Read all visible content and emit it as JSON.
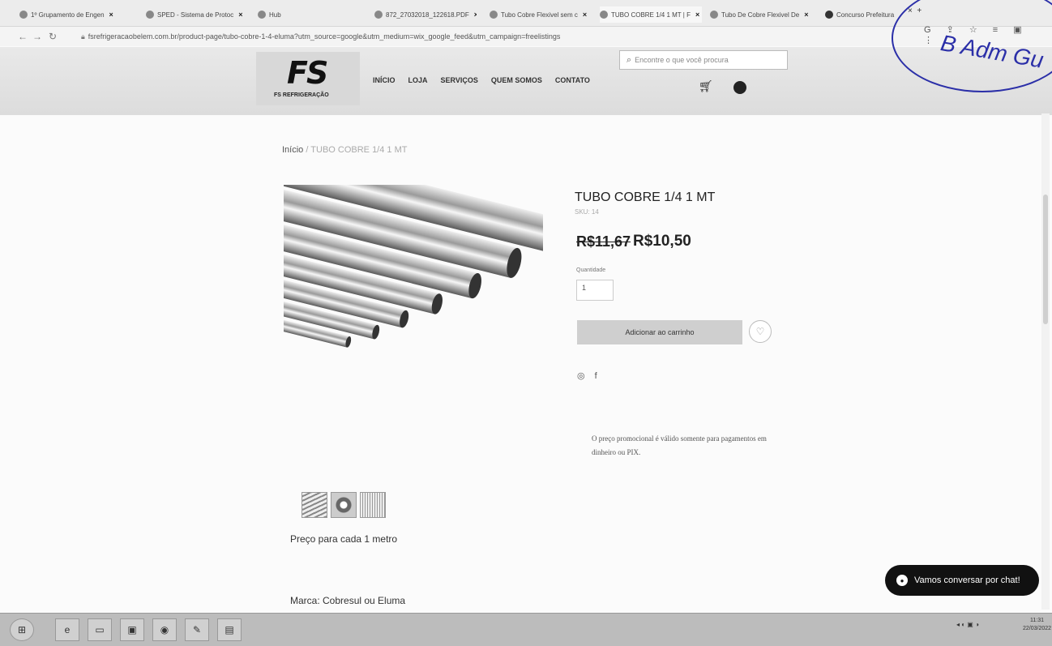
{
  "tabs": [
    {
      "label": "1º Grupamento de Engen"
    },
    {
      "label": "SPED - Sistema de Protoc"
    },
    {
      "label": "Hub"
    },
    {
      "label": "872_27032018_122618.PDF"
    },
    {
      "label": "Tubo Cobre Flexivel sem c"
    },
    {
      "label": "TUBO COBRE 1/4 1 MT | F"
    },
    {
      "label": "Tubo De Cobre Flexivel De"
    },
    {
      "label": "Concurso Prefeitura"
    }
  ],
  "browser": {
    "url": "fsrefrigeracaobelem.com.br/product-page/tubo-cobre-1-4-eluma?utm_source=google&utm_medium=wix_google_feed&utm_campaign=freelistings"
  },
  "stamp_text": "B Adm Gu",
  "site": {
    "logo_mark": "FS",
    "logo_text": "FS REFRIGERAÇÃO",
    "menu": [
      "INÍCIO",
      "LOJA",
      "SERVIÇOS",
      "QUEM SOMOS",
      "CONTATO"
    ],
    "search_placeholder": "Encontre o que você procura"
  },
  "breadcrumb": {
    "home": "Início",
    "separator": "/",
    "current": "TUBO COBRE 1/4 1 MT"
  },
  "product": {
    "title": "TUBO COBRE 1/4 1 MT",
    "sku": "SKU: 14",
    "old_price": "R$11,67",
    "new_price": "R$10,50",
    "quantity_label": "Quantidade",
    "quantity": "1",
    "add_to_cart": "Adicionar ao carrinho",
    "promo_note": "O preço promocional é válido somente para pagamentos em dinheiro ou PIX.",
    "description_1": "Preço para cada 1 metro",
    "description_2": "Marca: Cobresul ou Eluma"
  },
  "chat": {
    "label": "Vamos conversar por chat!"
  },
  "taskbar": {
    "time": "11:31",
    "date": "22/03/2022"
  },
  "colors": {
    "accent": "#111111",
    "stamp_ink": "#2b2fa8"
  },
  "icons": [
    "search-icon",
    "cart-icon",
    "user-icon",
    "heart-icon",
    "whatsapp-icon",
    "facebook-icon",
    "chat-icon"
  ]
}
